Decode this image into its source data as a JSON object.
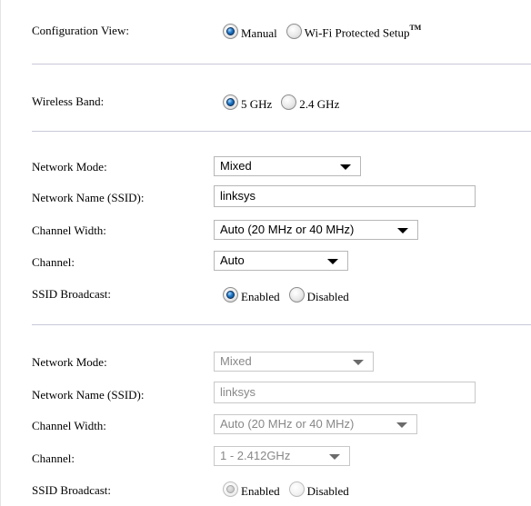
{
  "config": {
    "label": "Configuration View:",
    "options": [
      "Manual",
      "Wi-Fi Protected Setup"
    ],
    "tm": "TM",
    "selected": "Manual"
  },
  "band": {
    "label": "Wireless Band:",
    "options": [
      "5 GHz",
      "2.4 GHz"
    ],
    "selected": "5 GHz"
  },
  "section1": {
    "network_mode_label": "Network Mode:",
    "network_mode_value": "Mixed",
    "ssid_label": "Network Name (SSID):",
    "ssid_value": "linksys",
    "channel_width_label": "Channel Width:",
    "channel_width_value": "Auto (20 MHz or 40 MHz)",
    "channel_label": "Channel:",
    "channel_value": "Auto",
    "broadcast_label": "SSID Broadcast:",
    "broadcast_options": [
      "Enabled",
      "Disabled"
    ],
    "broadcast_selected": "Enabled"
  },
  "section2": {
    "network_mode_label": "Network Mode:",
    "network_mode_value": "Mixed",
    "ssid_label": "Network Name (SSID):",
    "ssid_value": "linksys",
    "channel_width_label": "Channel Width:",
    "channel_width_value": "Auto (20 MHz or 40 MHz)",
    "channel_label": "Channel:",
    "channel_value": "1 - 2.412GHz",
    "broadcast_label": "SSID Broadcast:",
    "broadcast_options": [
      "Enabled",
      "Disabled"
    ],
    "broadcast_selected": "Enabled",
    "disabled": true
  }
}
